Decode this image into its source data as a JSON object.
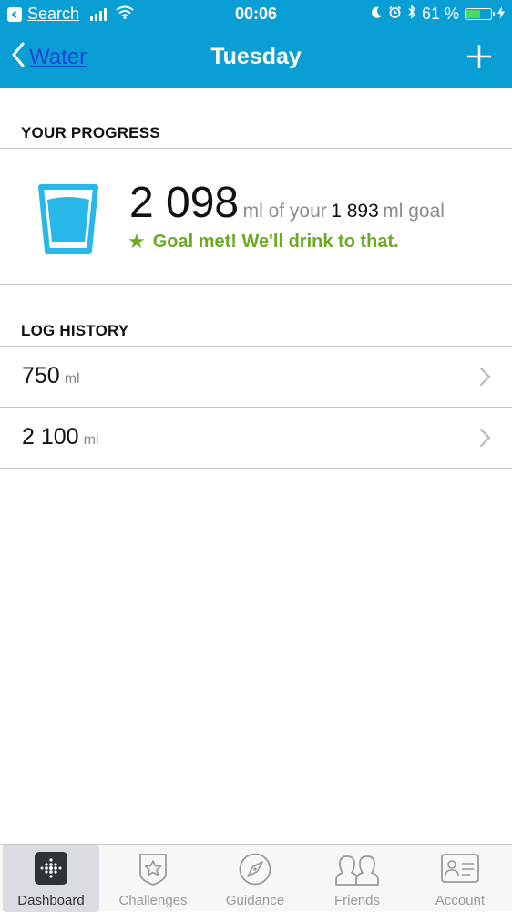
{
  "status_bar": {
    "back_app": "Search",
    "time": "00:06",
    "battery_percent": "61 %",
    "battery_level": 0.61
  },
  "nav": {
    "back_label": "Water",
    "title": "Tuesday"
  },
  "progress": {
    "section_title": "YOUR PROGRESS",
    "amount": "2 098",
    "amount_suffix": "ml of your",
    "goal_value": "1 893",
    "goal_suffix": "ml goal",
    "goal_message": "Goal met! We'll drink to that."
  },
  "log_history": {
    "section_title": "LOG HISTORY",
    "entries": [
      {
        "value": "750",
        "unit": "ml"
      },
      {
        "value": "2 100",
        "unit": "ml"
      }
    ]
  },
  "tabs": [
    {
      "label": "Dashboard",
      "icon": "dashboard-icon"
    },
    {
      "label": "Challenges",
      "icon": "challenges-icon"
    },
    {
      "label": "Guidance",
      "icon": "compass-icon"
    },
    {
      "label": "Friends",
      "icon": "friends-icon"
    },
    {
      "label": "Account",
      "icon": "account-icon"
    }
  ],
  "colors": {
    "header": "#0a9fd4",
    "goal_green": "#6aab22",
    "glass_blue": "#29b6e8"
  }
}
